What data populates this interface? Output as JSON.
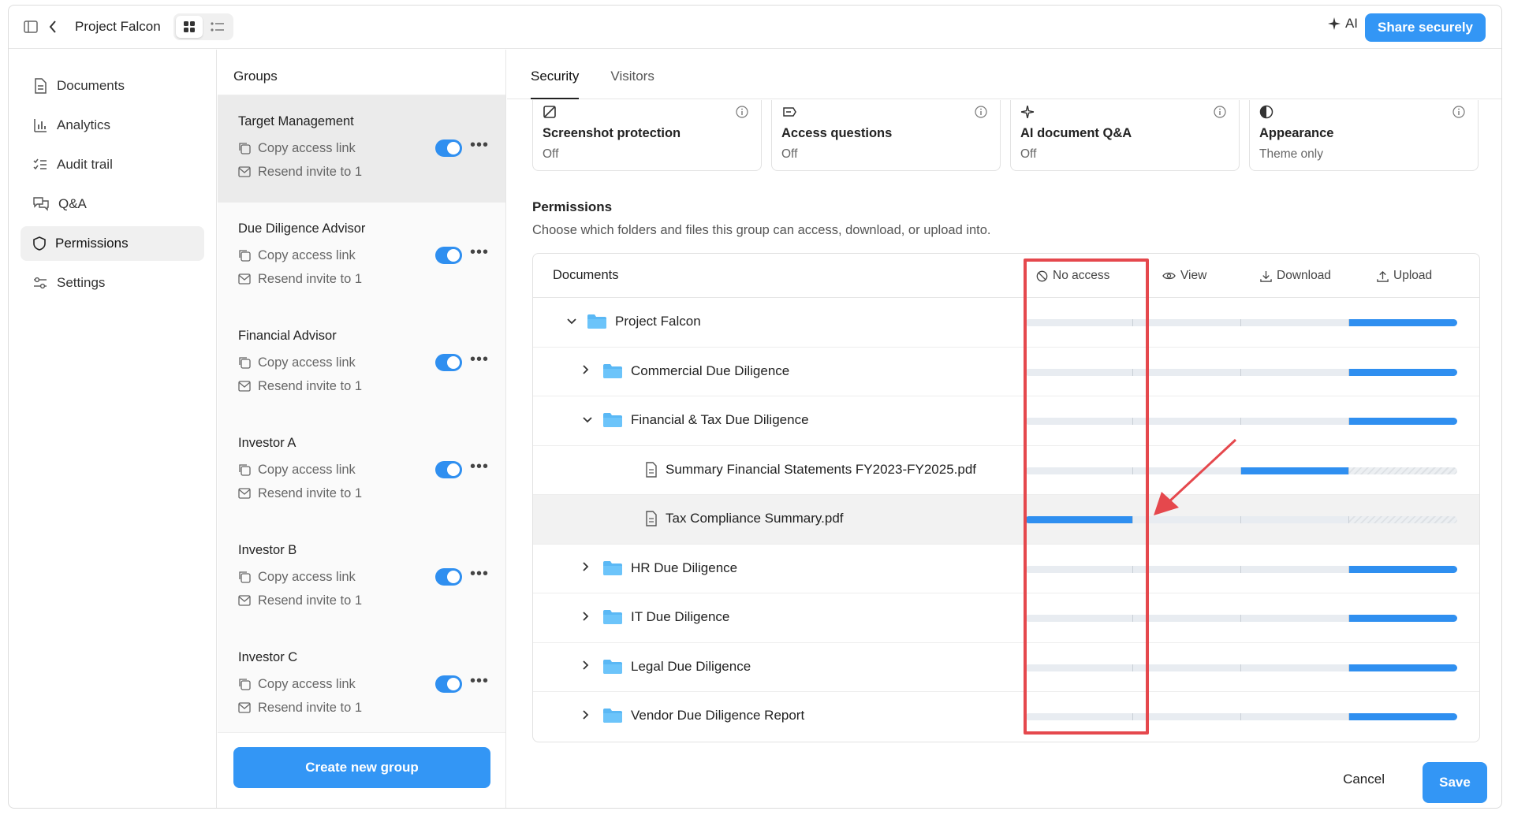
{
  "app": {
    "title": "Project Falcon",
    "ai_label": "AI",
    "share_label": "Share securely"
  },
  "nav": {
    "items": [
      {
        "label": "Documents",
        "icon": "document-icon"
      },
      {
        "label": "Analytics",
        "icon": "bar-chart-icon"
      },
      {
        "label": "Audit trail",
        "icon": "checklist-icon"
      },
      {
        "label": "Q&A",
        "icon": "chat-icon"
      },
      {
        "label": "Permissions",
        "icon": "shield-icon",
        "active": true
      },
      {
        "label": "Settings",
        "icon": "sliders-icon"
      }
    ]
  },
  "groups": {
    "title": "Groups",
    "copy_label": "Copy access link",
    "resend_label": "Resend invite to 1",
    "create_label": "Create new group",
    "items": [
      {
        "name": "Target Management",
        "enabled": true
      },
      {
        "name": "Due Diligence Advisor",
        "enabled": true
      },
      {
        "name": "Financial Advisor",
        "enabled": true
      },
      {
        "name": "Investor A",
        "enabled": true
      },
      {
        "name": "Investor B",
        "enabled": true
      },
      {
        "name": "Investor C",
        "enabled": true
      }
    ]
  },
  "tabs": [
    "Security",
    "Visitors"
  ],
  "cards": [
    {
      "title": "Screenshot protection",
      "status": "Off",
      "icon": "screenshot-off-icon"
    },
    {
      "title": "Access questions",
      "status": "Off",
      "icon": "question-tag-icon"
    },
    {
      "title": "AI document Q&A",
      "status": "Off",
      "icon": "sparkle-icon"
    },
    {
      "title": "Appearance",
      "status": "Theme only",
      "icon": "contrast-icon"
    }
  ],
  "permissions": {
    "title": "Permissions",
    "subtitle": "Choose which folders and files this group can access, download, or upload into.",
    "doc_header": "Documents",
    "columns": [
      "No access",
      "View",
      "Download",
      "Upload"
    ],
    "rows": [
      {
        "name": "Project Falcon",
        "type": "folder",
        "chevron": "down",
        "level": 0,
        "access": "Upload"
      },
      {
        "name": "Commercial Due Diligence",
        "type": "folder",
        "chevron": "right",
        "level": 1,
        "access": "Upload"
      },
      {
        "name": "Financial & Tax Due Diligence",
        "type": "folder",
        "chevron": "down",
        "level": 1,
        "access": "Upload"
      },
      {
        "name": "Summary Financial Statements FY2023-FY2025.pdf",
        "type": "file",
        "chevron": "",
        "level": 2,
        "access": "Download"
      },
      {
        "name": "Tax Compliance Summary.pdf",
        "type": "file",
        "chevron": "",
        "level": 2,
        "access": "No access",
        "highlighted": true
      },
      {
        "name": "HR Due Diligence",
        "type": "folder",
        "chevron": "right",
        "level": 1,
        "access": "Upload"
      },
      {
        "name": "IT Due Diligence",
        "type": "folder",
        "chevron": "right",
        "level": 1,
        "access": "Upload"
      },
      {
        "name": "Legal Due Diligence",
        "type": "folder",
        "chevron": "right",
        "level": 1,
        "access": "Upload"
      },
      {
        "name": "Vendor Due Diligence Report",
        "type": "folder",
        "chevron": "right",
        "level": 1,
        "access": "Upload"
      }
    ]
  },
  "footer": {
    "cancel_label": "Cancel",
    "save_label": "Save"
  },
  "colors": {
    "accent": "#3396f5",
    "annotation": "#e5484d"
  }
}
